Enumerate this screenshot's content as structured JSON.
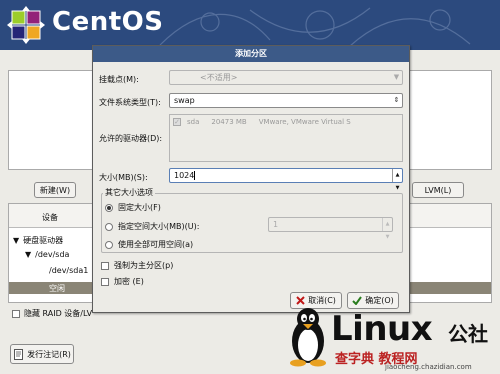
{
  "banner": {
    "brand": "CentOS"
  },
  "background": {
    "new_button": "新建(W)",
    "lvm_button": "LVM(L)",
    "device_header": "设备",
    "tree": [
      {
        "label": "硬盘驱动器",
        "expander": "▼"
      },
      {
        "label": "/dev/sda",
        "expander": "▼"
      },
      {
        "label": "/dev/sda1",
        "expander": ""
      }
    ],
    "selected_row": "空闲",
    "raid_label": "隐藏 RAID 设备/LV",
    "release_notes_button": "发行注记(R)"
  },
  "dialog": {
    "title": "添加分区",
    "mount_point": {
      "label": "挂载点(M):",
      "value": "<不适用>"
    },
    "fs_type": {
      "label": "文件系统类型(T):",
      "value": "swap"
    },
    "allowed_drives": {
      "label": "允许的驱动器(D):",
      "drive": {
        "name": "sda",
        "size": "20473 MB",
        "model": "VMware, VMware Virtual S",
        "checked": true
      }
    },
    "size": {
      "label": "大小(MB)(S):",
      "value": "1024"
    },
    "other_options": {
      "title": "其它大小选项",
      "fixed": "固定大小(F)",
      "upto": "指定空间大小(MB)(U):",
      "upto_value": "1",
      "fill": "使用全部可用空间(a)",
      "selected": "fixed"
    },
    "primary": {
      "label": "强制为主分区(p)",
      "checked": false
    },
    "encrypt": {
      "label": "加密 (E)",
      "checked": false
    },
    "cancel_button": "取消(C)",
    "ok_button": "确定(O)"
  },
  "watermark": {
    "brand": "Linux",
    "cn": "公社",
    "sub": "查字典 教程网",
    "url": "jiaocheng.chazidian.com"
  },
  "colors": {
    "banner": "#2c4a7e",
    "dialog_title": "#3c5a88",
    "selection": "#8a8576",
    "watermark_red": "#b22222"
  }
}
